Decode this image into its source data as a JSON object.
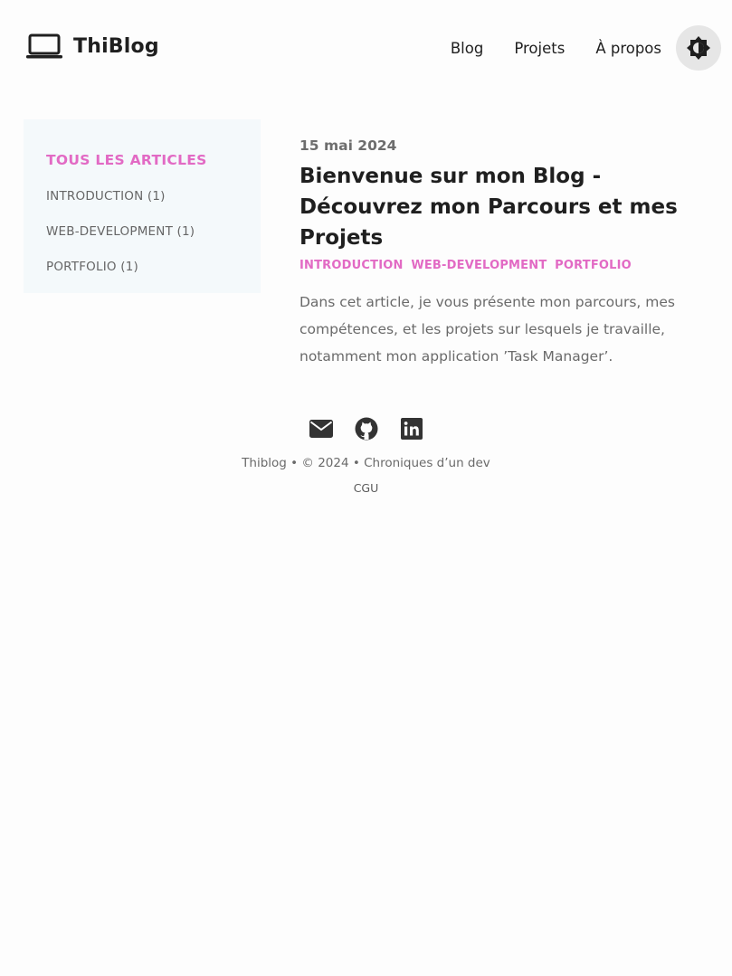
{
  "header": {
    "brand": "ThiBlog",
    "logo_icon": "laptop-icon",
    "nav": [
      {
        "label": "Blog"
      },
      {
        "label": "Projets"
      },
      {
        "label": "À propos"
      }
    ],
    "theme_toggle_icon": "contrast-icon"
  },
  "sidebar": {
    "heading": "TOUS LES ARTICLES",
    "categories": [
      {
        "label": "INTRODUCTION (1)"
      },
      {
        "label": "WEB-DEVELOPMENT (1)"
      },
      {
        "label": "PORTFOLIO (1)"
      }
    ]
  },
  "article": {
    "date": "15 mai 2024",
    "title": "Bienvenue sur mon Blog - Découvrez mon Parcours et mes Projets",
    "tags": [
      "INTRODUCTION",
      "WEB-DEVELOPMENT",
      "PORTFOLIO"
    ],
    "excerpt": "Dans cet article, je vous présente mon parcours, mes compétences, et les projets sur lesquels je travaille, notamment mon application ’Task Manager’."
  },
  "footer": {
    "social_icons": [
      "mail-icon",
      "github-icon",
      "linkedin-icon"
    ],
    "copyright": "Thiblog • © 2024 • Chroniques d’un dev",
    "cgu": "CGU"
  },
  "colors": {
    "accent": "#e26ac4",
    "sidebar_bg": "#f4f9fb",
    "text": "#1f1f1f",
    "muted": "#6a6a6a"
  }
}
